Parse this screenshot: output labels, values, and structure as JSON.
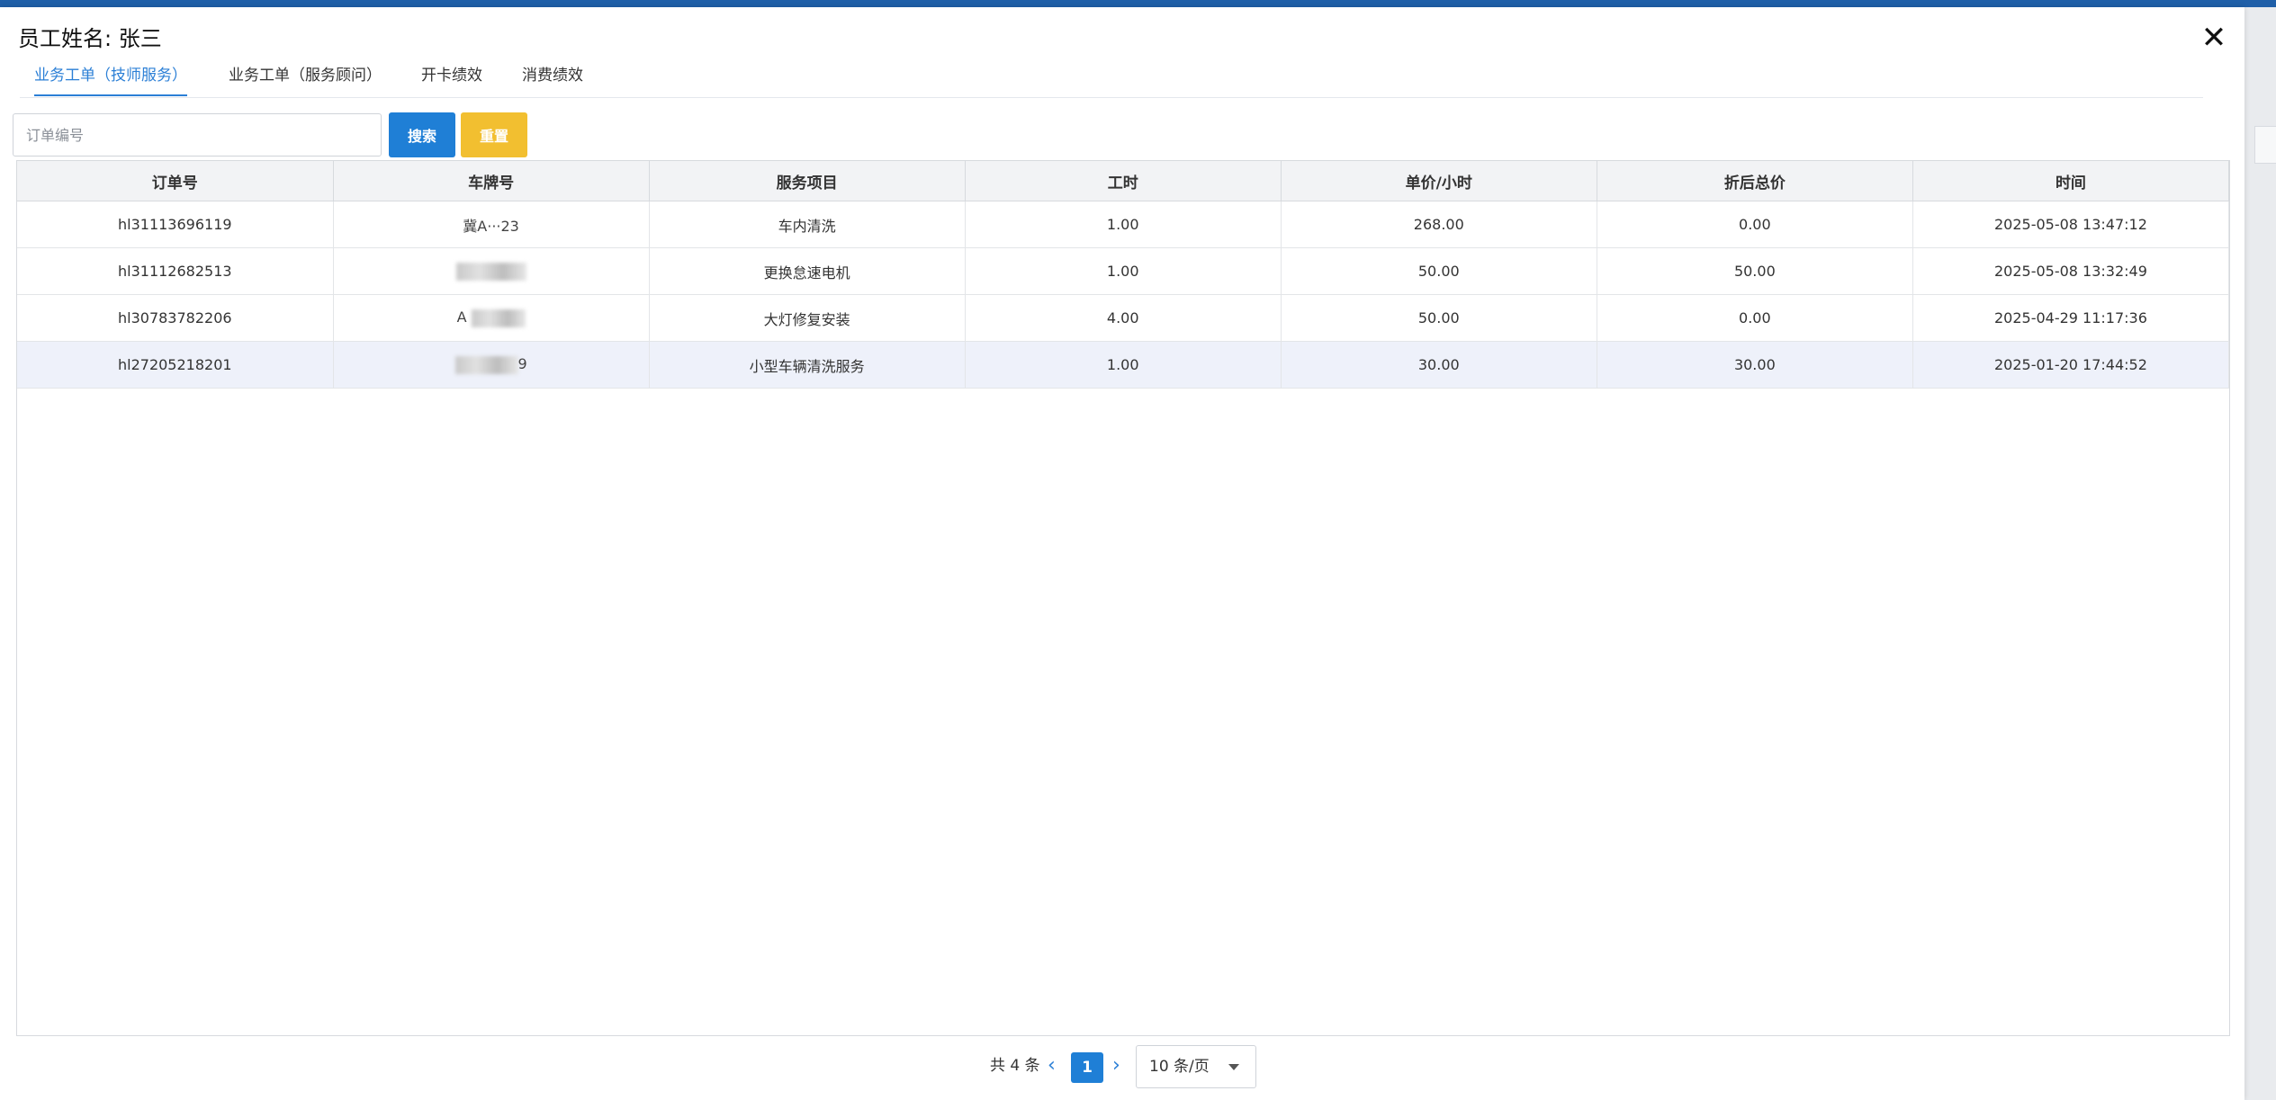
{
  "dialog": {
    "title": "员工姓名: 张三",
    "close_icon": "close-icon"
  },
  "tabs": [
    {
      "label": "业务工单（技师服务）",
      "active": true
    },
    {
      "label": "业务工单（服务顾问）",
      "active": false
    },
    {
      "label": "开卡绩效",
      "active": false
    },
    {
      "label": "消费绩效",
      "active": false
    }
  ],
  "search": {
    "placeholder": "订单编号",
    "value": "",
    "search_label": "搜索",
    "reset_label": "重置"
  },
  "table": {
    "columns": [
      "订单号",
      "车牌号",
      "服务项目",
      "工时",
      "单价/小时",
      "折后总价",
      "时间"
    ],
    "rows": [
      {
        "order": "hl31113696119",
        "plate": "冀A···23",
        "service": "车内清洗",
        "hours": "1.00",
        "price": "268.00",
        "total": "0.00",
        "time": "2025-05-08 13:47:12"
      },
      {
        "order": "hl31112682513",
        "plate": "",
        "service": "更换怠速电机",
        "hours": "1.00",
        "price": "50.00",
        "total": "50.00",
        "time": "2025-05-08 13:32:49"
      },
      {
        "order": "hl30783782206",
        "plate": "A",
        "service": "大灯修复安装",
        "hours": "4.00",
        "price": "50.00",
        "total": "0.00",
        "time": "2025-04-29 11:17:36"
      },
      {
        "order": "hl27205218201",
        "plate": "9",
        "service": "小型车辆清洗服务",
        "hours": "1.00",
        "price": "30.00",
        "total": "30.00",
        "time": "2025-01-20 17:44:52"
      }
    ]
  },
  "pagination": {
    "total_label": "共 4 条",
    "current_page": "1",
    "page_size": "10 条/页"
  },
  "colors": {
    "accent": "#1f7fd6",
    "reset": "#f2bf30",
    "header_bg": "#f2f3f5"
  }
}
